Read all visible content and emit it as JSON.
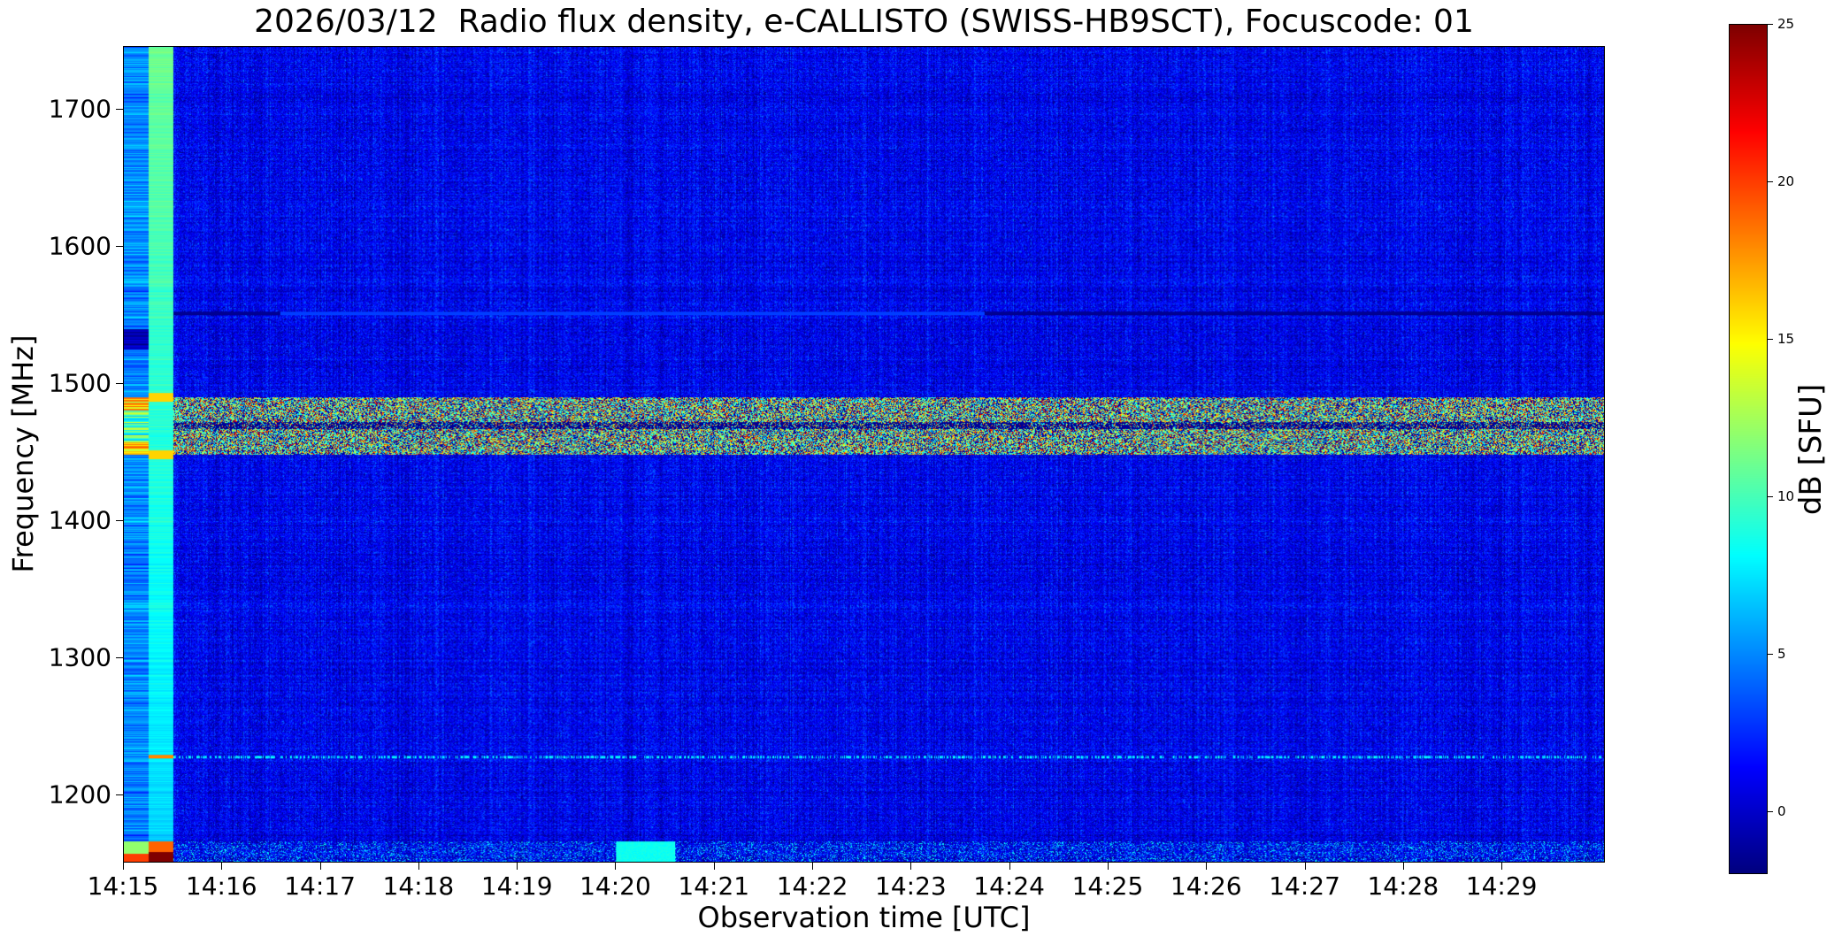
{
  "chart_data": {
    "type": "heatmap",
    "title": "2026/03/12  Radio flux density, e-CALLISTO (SWISS-HB9SCT), Focuscode: 01",
    "xlabel": "Observation time [UTC]",
    "ylabel": "Frequency [MHz]",
    "colorbar_label": "dB [SFU]",
    "colormap": "jet",
    "x_range": [
      "14:15:00",
      "14:30:03"
    ],
    "y_range": [
      1150,
      1746
    ],
    "color_range": [
      -2,
      25
    ],
    "x_ticks": [
      "14:15",
      "14:16",
      "14:17",
      "14:18",
      "14:19",
      "14:20",
      "14:21",
      "14:22",
      "14:23",
      "14:24",
      "14:25",
      "14:26",
      "14:27",
      "14:28",
      "14:29"
    ],
    "y_ticks": [
      1200,
      1300,
      1400,
      1500,
      1600,
      1700
    ],
    "color_ticks": [
      0,
      5,
      10,
      15,
      20,
      25
    ],
    "grid": false,
    "features": {
      "background_level_db": 1,
      "calibration_start": [
        "14:15:00",
        "14:15:30"
      ],
      "interference_band_mhz": [
        1448,
        1490
      ],
      "interference_band_peak_db": 22,
      "line_1227_mhz_level_db": 6,
      "line_1551_mhz_level_db": 3,
      "low_edge_band_mhz": [
        1150,
        1165
      ],
      "low_edge_burst": [
        "14:20:00",
        "14:20:36"
      ]
    }
  }
}
